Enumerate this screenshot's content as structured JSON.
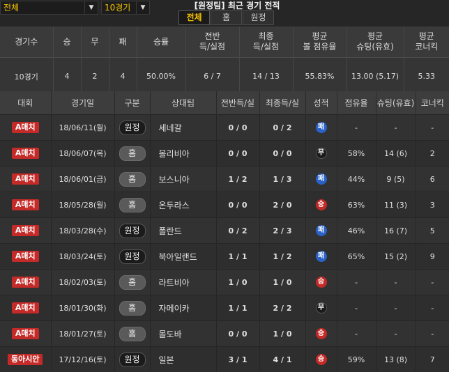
{
  "filters": {
    "scope": "전체",
    "games": "10경기"
  },
  "title": "[원정팀] 최근 경기 전적",
  "tabs": [
    "전체",
    "홈",
    "원정"
  ],
  "summary": {
    "headers": [
      "경기수",
      "승",
      "무",
      "패",
      "승률",
      "전반\n득/실점",
      "최종\n득/실점",
      "평균\n볼 점유율",
      "평균\n슈팅(유효)",
      "평균\n코너킥"
    ],
    "values": [
      "10경기",
      "4",
      "2",
      "4",
      "50.00%",
      "6 / 7",
      "14 / 13",
      "55.83%",
      "13.00 (5.17)",
      "5.33"
    ]
  },
  "columns": [
    "대회",
    "경기일",
    "구분",
    "상대팀",
    "전반득/실",
    "최종득/실",
    "성적",
    "점유율",
    "슈팅(유효)",
    "코너킥"
  ],
  "matches": [
    {
      "comp": "A매치",
      "date": "18/06/11(월)",
      "venue": "원정",
      "type": "away",
      "opp": "세네갈",
      "half": "0 / 0",
      "final": "0 / 2",
      "result": "패",
      "rtype": "loss",
      "poss": "-",
      "shots": "-",
      "corners": "-"
    },
    {
      "comp": "A매치",
      "date": "18/06/07(목)",
      "venue": "홈",
      "type": "home",
      "opp": "볼리비아",
      "half": "0 / 0",
      "final": "0 / 0",
      "result": "무",
      "rtype": "draw",
      "poss": "58%",
      "shots": "14 (6)",
      "corners": "2"
    },
    {
      "comp": "A매치",
      "date": "18/06/01(금)",
      "venue": "홈",
      "type": "home",
      "opp": "보스니아",
      "half": "1 / 2",
      "final": "1 / 3",
      "result": "패",
      "rtype": "loss",
      "poss": "44%",
      "shots": "9 (5)",
      "corners": "6"
    },
    {
      "comp": "A매치",
      "date": "18/05/28(월)",
      "venue": "홈",
      "type": "home",
      "opp": "온두라스",
      "half": "0 / 0",
      "final": "2 / 0",
      "result": "승",
      "rtype": "win",
      "poss": "63%",
      "shots": "11 (3)",
      "corners": "3"
    },
    {
      "comp": "A매치",
      "date": "18/03/28(수)",
      "venue": "원정",
      "type": "away",
      "opp": "폴란드",
      "half": "0 / 2",
      "final": "2 / 3",
      "result": "패",
      "rtype": "loss",
      "poss": "46%",
      "shots": "16 (7)",
      "corners": "5"
    },
    {
      "comp": "A매치",
      "date": "18/03/24(토)",
      "venue": "원정",
      "type": "away",
      "opp": "북아일랜드",
      "half": "1 / 1",
      "final": "1 / 2",
      "result": "패",
      "rtype": "loss",
      "poss": "65%",
      "shots": "15 (2)",
      "corners": "9"
    },
    {
      "comp": "A매치",
      "date": "18/02/03(토)",
      "venue": "홈",
      "type": "home",
      "opp": "라트비아",
      "half": "1 / 0",
      "final": "1 / 0",
      "result": "승",
      "rtype": "win",
      "poss": "-",
      "shots": "-",
      "corners": "-"
    },
    {
      "comp": "A매치",
      "date": "18/01/30(화)",
      "venue": "홈",
      "type": "home",
      "opp": "자메이카",
      "half": "1 / 1",
      "final": "2 / 2",
      "result": "무",
      "rtype": "draw",
      "poss": "-",
      "shots": "-",
      "corners": "-"
    },
    {
      "comp": "A매치",
      "date": "18/01/27(토)",
      "venue": "홈",
      "type": "home",
      "opp": "몰도바",
      "half": "0 / 0",
      "final": "1 / 0",
      "result": "승",
      "rtype": "win",
      "poss": "-",
      "shots": "-",
      "corners": "-"
    },
    {
      "comp": "동아시안",
      "date": "17/12/16(토)",
      "venue": "원정",
      "type": "away",
      "opp": "일본",
      "half": "3 / 1",
      "final": "4 / 1",
      "result": "승",
      "rtype": "win",
      "poss": "59%",
      "shots": "13 (8)",
      "corners": "7"
    }
  ],
  "colors": {
    "accent": "#f2c100",
    "win": "#c42a27",
    "loss": "#2a62c8",
    "draw": "#1a1a1a"
  }
}
